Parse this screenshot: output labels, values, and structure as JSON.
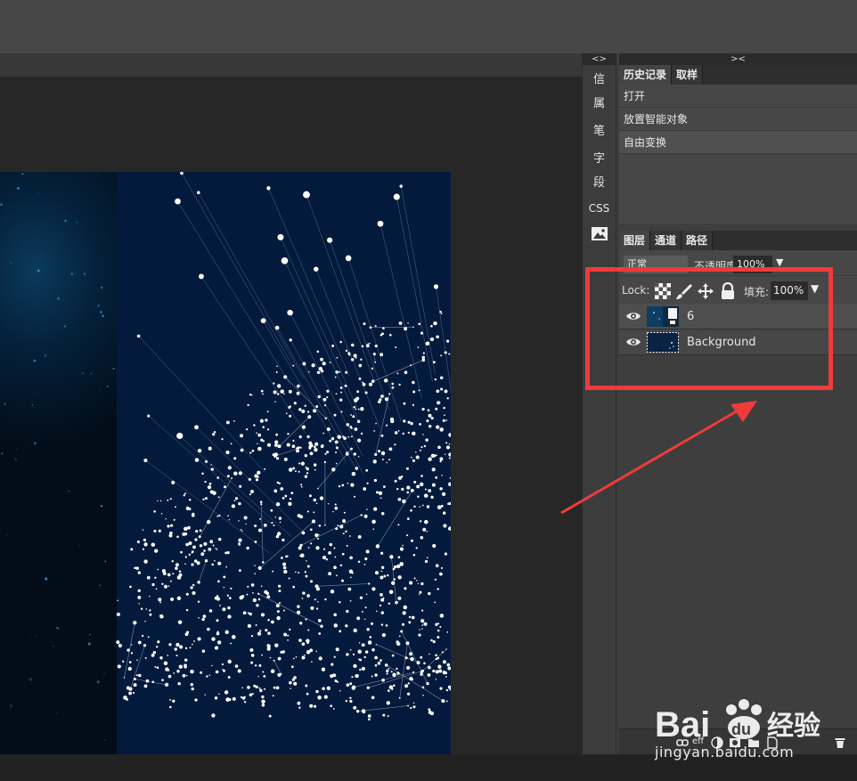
{
  "icon_strip": {
    "collapse_label": "<>",
    "items": [
      {
        "label": "信"
      },
      {
        "label": "属"
      },
      {
        "label": "笔"
      },
      {
        "label": "字"
      },
      {
        "label": "段"
      },
      {
        "label": "CSS"
      }
    ],
    "image_icon": "image-icon"
  },
  "panel": {
    "collapse_label": "><",
    "history_tabs": [
      {
        "label": "历史记录"
      },
      {
        "label": "取样"
      }
    ],
    "history_items": [
      {
        "label": "打开"
      },
      {
        "label": "放置智能对象"
      },
      {
        "label": "自由变换"
      }
    ],
    "layer_tabs": [
      {
        "label": "图层"
      },
      {
        "label": "通道"
      },
      {
        "label": "路径"
      }
    ],
    "blend_mode": "正常",
    "opacity_label": "不透明度",
    "opacity_value": "100%",
    "lock_label": "Lock:",
    "fill_label": "填充:",
    "fill_value": "100%",
    "layers": [
      {
        "name": "6",
        "visible": true
      },
      {
        "name": "Background",
        "visible": true
      }
    ],
    "bottom_icons": [
      "link-icon",
      "eff",
      "adjust-icon",
      "mask-icon",
      "folder-icon",
      "new-layer-icon",
      "trash-icon"
    ],
    "effects_label": "eff"
  },
  "annotation": {
    "highlight_color": "#ef3b3b"
  },
  "watermark": {
    "brand": "Bai du 经验",
    "url": "jingyan.baidu.com"
  }
}
